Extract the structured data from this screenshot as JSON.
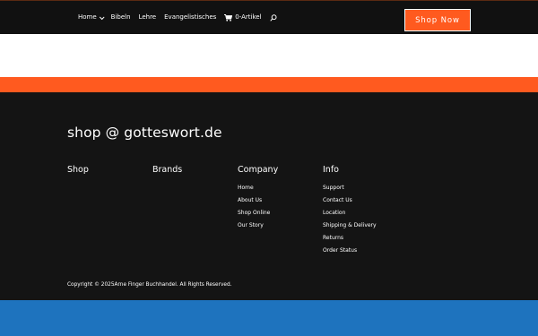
{
  "colors": {
    "header_bg": "#111111",
    "accent": "#ff5a1f",
    "footer_bg": "#141414",
    "bottom_band": "#1e73be"
  },
  "nav": {
    "items": [
      {
        "label": "Home",
        "has_dropdown": true
      },
      {
        "label": "Bibeln"
      },
      {
        "label": "Lehre"
      },
      {
        "label": "Evangelistisches"
      }
    ],
    "cart_label": "0-Artikel",
    "cart_icon": "shopping-cart-icon",
    "search_icon": "search-icon"
  },
  "header": {
    "cta_label": "Shop Now"
  },
  "footer": {
    "title": "shop @ gotteswort.de",
    "columns": [
      {
        "heading": "Shop",
        "links": []
      },
      {
        "heading": "Brands",
        "links": []
      },
      {
        "heading": "Company",
        "links": [
          "Home",
          "About Us",
          "Shop Online",
          "Our Story"
        ]
      },
      {
        "heading": "Info",
        "links": [
          "Support",
          "Contact Us",
          "Location",
          "Shipping & Delivery",
          "Returns",
          "Order Status"
        ]
      }
    ],
    "copyright": "Copyright © 2025Arne Finger Buchhandel. All Rights Reserved."
  }
}
